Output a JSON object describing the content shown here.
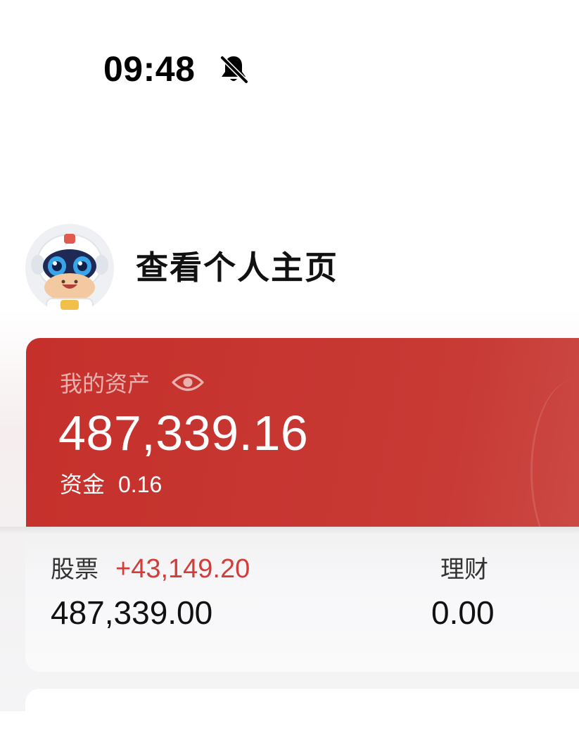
{
  "status_bar": {
    "time": "09:48",
    "mute_icon": "bell-slash-icon"
  },
  "profile": {
    "avatar_icon": "robot-mascot-avatar",
    "link_text": "查看个人主页"
  },
  "assets": {
    "label": "我的资产",
    "visibility_icon": "eye-icon",
    "total": "487,339.16",
    "cash_label": "资金",
    "cash_value": "0.16",
    "accent_color": "#c5302b"
  },
  "breakdown": {
    "stock": {
      "label": "股票",
      "change": "+43,149.20",
      "value": "487,339.00",
      "change_color": "#d23d3a"
    },
    "finance": {
      "label": "理财",
      "value": "0.00"
    }
  }
}
